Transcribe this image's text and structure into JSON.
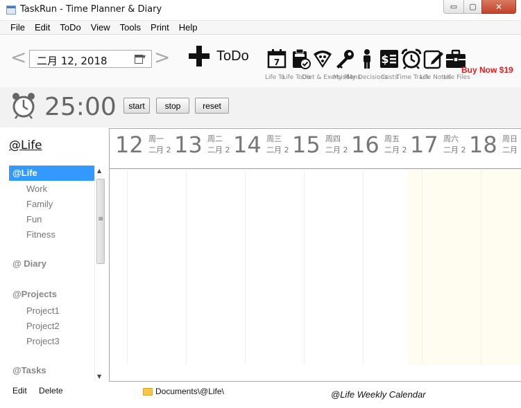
{
  "window": {
    "title": "TaskRun - Time Planner & Diary",
    "min_glyph": "▭",
    "max_glyph": "▢",
    "close_glyph": "✕"
  },
  "menu": [
    "File",
    "Edit",
    "ToDo",
    "View",
    "Tools",
    "Print",
    "Help"
  ],
  "toolbar": {
    "prev_arrow": "<",
    "next_arrow": ">",
    "date_value": "二月  12, 2018",
    "todo_label": "ToDo",
    "calendar_day_number": "7",
    "tools": [
      {
        "label": "Life To",
        "icon": "calendar-icon"
      },
      {
        "label": "Life ToDo",
        "icon": "clipboard-check-icon"
      },
      {
        "label": "Diet & Exercise",
        "icon": "pizza-slice-icon"
      },
      {
        "label": "My Plans",
        "icon": "key-icon"
      },
      {
        "label": "My Decisions",
        "icon": "person-icon"
      },
      {
        "label": "Costs",
        "icon": "receipt-dollar-icon"
      },
      {
        "label": "Time Track",
        "icon": "alarm-clock-icon"
      },
      {
        "label": "Life Notes",
        "icon": "edit-note-icon"
      },
      {
        "label": "Life Files",
        "icon": "briefcase-icon"
      }
    ],
    "buy_now": "Buy Now $19"
  },
  "timer": {
    "value": "25:00",
    "start": "start",
    "stop": "stop",
    "reset": "reset"
  },
  "left": {
    "title": "@Life",
    "tree": [
      {
        "label": "@Life",
        "kind": "group",
        "selected": true
      },
      {
        "label": "Work",
        "kind": "sub"
      },
      {
        "label": "Family",
        "kind": "sub"
      },
      {
        "label": "Fun",
        "kind": "sub"
      },
      {
        "label": "Fitness",
        "kind": "sub"
      },
      {
        "label": "@ Diary",
        "kind": "group"
      },
      {
        "label": "@Projects",
        "kind": "group"
      },
      {
        "label": "Project1",
        "kind": "sub"
      },
      {
        "label": "Project2",
        "kind": "sub"
      },
      {
        "label": "Project3",
        "kind": "sub"
      },
      {
        "label": "@Tasks",
        "kind": "group"
      }
    ],
    "edit": "Edit",
    "delete": "Delete"
  },
  "calendar": {
    "days": [
      {
        "num": "12",
        "week": "",
        "month": ""
      },
      {
        "num": "13",
        "week": "周一",
        "month": "二月 2"
      },
      {
        "num": "14",
        "week": "周二",
        "month": "二月 2"
      },
      {
        "num": "15",
        "week": "周三",
        "month": "二月 2"
      },
      {
        "num": "16",
        "week": "周四",
        "month": "二月 2"
      },
      {
        "num": "17",
        "week": "周五",
        "month": "二月 2"
      },
      {
        "num": "18",
        "week": "周六",
        "month": "二月 2"
      },
      {
        "num": "",
        "week": "周日",
        "month": "二月"
      }
    ]
  },
  "footer": {
    "path": "Documents\\@Life\\",
    "caption": "@Life Weekly Calendar"
  }
}
